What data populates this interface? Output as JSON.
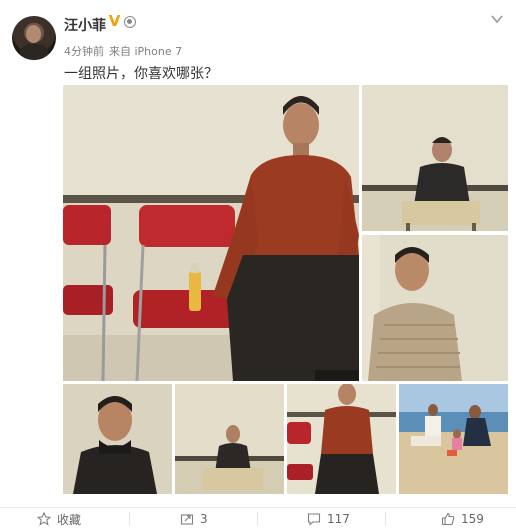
{
  "post": {
    "author": "汪小菲",
    "verified_badge": "V",
    "time": "4分钟前",
    "source": "来自 iPhone 7",
    "text": "一组照片，你喜欢哪张？"
  },
  "icons": {
    "avatar": "user-avatar",
    "verified": "verified-v-badge",
    "member": "member-icon",
    "menu": "chevron-down-icon",
    "favorite": "star-icon",
    "repost": "repost-icon",
    "comment": "comment-icon",
    "like": "thumbs-up-icon"
  },
  "actions": {
    "favorite_label": "收藏",
    "repost_count": "3",
    "comment_count": "117",
    "like_count": "159"
  },
  "colors": {
    "verified": "#f2a300",
    "text": "#333333",
    "meta": "#808080",
    "chair_red": "#b8252a",
    "shirt_rust": "#9b3c22"
  },
  "photos": [
    {
      "name": "photo-1"
    },
    {
      "name": "photo-2"
    },
    {
      "name": "photo-3"
    },
    {
      "name": "photo-4"
    },
    {
      "name": "photo-5"
    },
    {
      "name": "photo-6"
    },
    {
      "name": "photo-7"
    }
  ]
}
